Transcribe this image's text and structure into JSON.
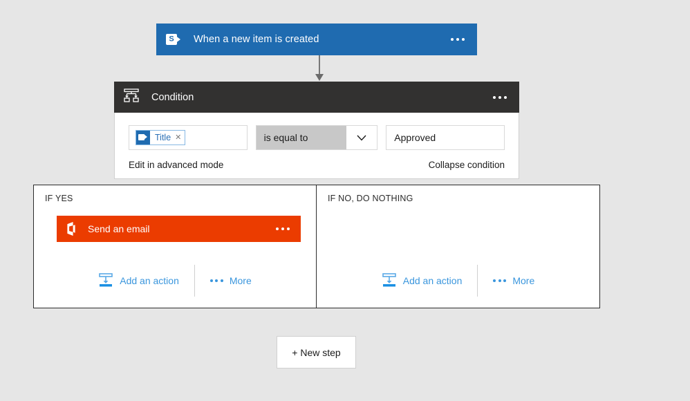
{
  "colors": {
    "background": "#e6e6e6",
    "trigger_blue": "#1f6bb0",
    "condition_dark": "#323130",
    "action_orange": "#eb3c00",
    "link_blue": "#3a96dd",
    "token_blue": "#2a6fb5",
    "operator_fill": "#c8c8c8",
    "connector_grey": "#787878"
  },
  "trigger": {
    "icon": "sharepoint-icon",
    "title": "When a new item is created",
    "menu_icon": "ellipsis-icon"
  },
  "connector": {
    "icon": "down-arrow-connector-icon"
  },
  "condition": {
    "icon": "condition-branch-icon",
    "title": "Condition",
    "menu_icon": "ellipsis-icon",
    "field": {
      "token_icon": "sharepoint-icon",
      "token_label": "Title",
      "remove_icon": "close-icon"
    },
    "operator": {
      "value": "is equal to",
      "chevron_icon": "chevron-down-icon"
    },
    "value": {
      "text": "Approved"
    },
    "advanced_mode_label": "Edit in advanced mode",
    "collapse_label": "Collapse condition"
  },
  "branches": [
    {
      "title": "IF YES",
      "action": {
        "icon": "office-365-outlook-icon",
        "label": "Send an email",
        "menu_icon": "ellipsis-icon"
      },
      "add_action_label": "Add an action",
      "add_action_icon": "insert-action-icon",
      "more_label": "More",
      "more_icon": "ellipsis-icon"
    },
    {
      "title": "IF NO, DO NOTHING",
      "action": null,
      "add_action_label": "Add an action",
      "add_action_icon": "insert-action-icon",
      "more_label": "More",
      "more_icon": "ellipsis-icon"
    }
  ],
  "new_step": {
    "label": "+ New step"
  }
}
